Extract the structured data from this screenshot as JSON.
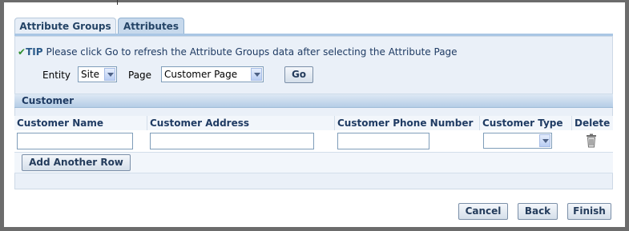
{
  "tabs": [
    {
      "label": "Attribute Groups",
      "active": false
    },
    {
      "label": "Attributes",
      "active": true
    }
  ],
  "tip": {
    "label": "TIP",
    "text": "Please click Go to refresh the Attribute Groups data after selecting the Attribute Page"
  },
  "filters": {
    "entity_label": "Entity",
    "entity_value": "Site",
    "page_label": "Page",
    "page_value": "Customer Page",
    "go_label": "Go"
  },
  "section": {
    "title": "Customer"
  },
  "table": {
    "columns": [
      "Customer Name",
      "Customer Address",
      "Customer Phone Number",
      "Customer Type",
      "Delete"
    ],
    "rows": [
      {
        "customer_name": "",
        "customer_address": "",
        "customer_phone": "",
        "customer_type": ""
      }
    ],
    "add_row_label": "Add Another Row"
  },
  "footer": {
    "cancel_label": "Cancel",
    "back_label": "Back",
    "finish_label": "Finish"
  },
  "colors": {
    "accent": "#1f3b63",
    "panel": "#eaf0f8",
    "section_header": "#b5cde6",
    "tip_check": "#2f8f2f"
  },
  "icons": [
    "check-icon",
    "dropdown-arrow-icon",
    "trash-icon"
  ]
}
